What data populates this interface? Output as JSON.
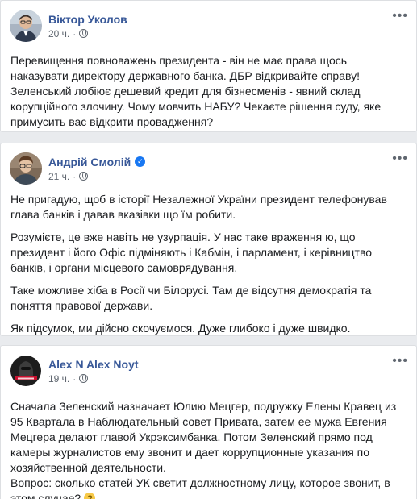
{
  "posts": [
    {
      "author": "Віктор Уколов",
      "time": "20 ч.",
      "separator": "·",
      "verified": false,
      "paragraphs": [
        "Перевищення повноважень президента - він не має права щось наказувати директору державного банка. ДБР відкривайте справу! Зеленський лобіює дешевий кредит для бізнесменів - явний склад корупційного злочину. Чому мовчить НАБУ? Чекаєте рішення суду, яке примусить вас відкрити провадження?"
      ]
    },
    {
      "author": "Андрій Смолій",
      "time": "21 ч.",
      "separator": "·",
      "verified": true,
      "paragraphs": [
        "Не пригадую, щоб в історії Незалежної України президент телефонував глава банків і давав вказівки що їм робити.",
        "Розумієте, це вже навіть не узурпація. У нас таке враження ю, що президент і його Офіс підміняють і Кабмін, і парламент, і керівництво банків, і органи місцевого самоврядування.",
        "Таке можливе хіба в Росії чи Білорусі. Там де відсутня демократія та поняття правової держави.",
        "Як підсумок, ми дійсно скочуємося. Дуже глибоко і дуже швидко."
      ]
    },
    {
      "author": "Alex N Alex Noyt",
      "time": "19 ч.",
      "separator": "·",
      "verified": false,
      "paragraphs": [
        "Сначала Зеленский назначает Юлию Мецгер, подружку Елены Кравец из 95 Квартала в Наблюдательный совет Привата, затем ее мужа Евгения Мецгера делают главой Укрэксимбанка. Потом Зеленский прямо под камеры журналистов ему звонит и дает коррупционные указания по хозяйственной деятельности.",
        "Вопрос: сколько статей УК светит должностному лицу, которое звонит, в этом случае?"
      ]
    }
  ],
  "ui": {
    "more_label": "•••"
  },
  "colors": {
    "author": "#385898",
    "text": "#1c1e21",
    "meta": "#606770",
    "background": "#e9ebee",
    "verified": "#1877f2"
  },
  "icons": {
    "privacy": "globe-icon",
    "menu": "more-options-icon",
    "badge": "verified-badge-icon",
    "reaction": "thinking-face-emoji-icon"
  }
}
